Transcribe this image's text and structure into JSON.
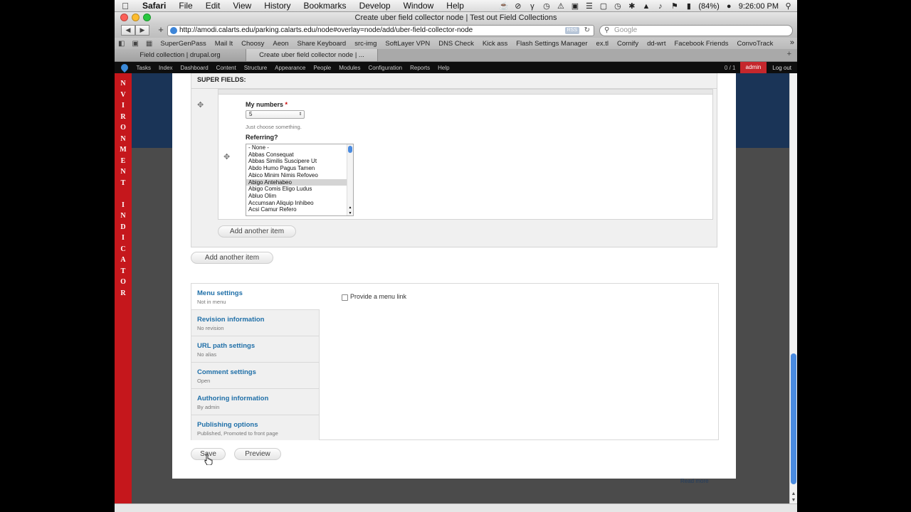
{
  "menubar": {
    "app": "Safari",
    "items": [
      "File",
      "Edit",
      "View",
      "History",
      "Bookmarks",
      "Develop",
      "Window",
      "Help"
    ],
    "battery": "(84%)",
    "clock": "9:26:00 PM"
  },
  "window": {
    "title": "Create uber field collector node | Test out Field Collections",
    "url": "http://amodi.calarts.edu/parking.calarts.edu/node#overlay=node/add/uber-field-collector-node",
    "rss": "RSS",
    "search_placeholder": "Google"
  },
  "bookmarks": [
    "SuperGenPass",
    "Mail It",
    "Choosy",
    "Aeon",
    "Share Keyboard",
    "src-img",
    "SoftLayer VPN",
    "DNS Check",
    "Kick ass",
    "Flash Settings Manager",
    "ex.tl",
    "Cornify",
    "dd-wrt",
    "Facebook Friends",
    "ConvoTrack"
  ],
  "tabs": [
    {
      "label": "Field collection | drupal.org"
    },
    {
      "label": "Create uber field collector node | ..."
    }
  ],
  "admin_toolbar": {
    "items": [
      "Tasks",
      "Index",
      "Dashboard",
      "Content",
      "Structure",
      "Appearance",
      "People",
      "Modules",
      "Configuration",
      "Reports",
      "Help"
    ],
    "count": "0 / 1",
    "user": "admin",
    "logout": "Log out"
  },
  "env_indicator": [
    "N",
    "V",
    "I",
    "R",
    "O",
    "N",
    "M",
    "E",
    "N",
    "T",
    " ",
    "I",
    "N",
    "D",
    "I",
    "C",
    "A",
    "T",
    "O",
    "R"
  ],
  "form": {
    "super_fields_label": "SUPER FIELDS:",
    "numbers_label": "My numbers",
    "required_mark": "*",
    "numbers_value": "5",
    "numbers_desc": "Just choose something.",
    "referring_label": "Referring?",
    "referring_options": [
      "- None -",
      "Abbas Consequat",
      "Abbas Similis Suscipere Ut",
      "Abdo Humo Pagus Tamen",
      "Abico Minim Nimis Refoveo",
      "Abigo Antehabeo",
      "Abigo Comis Eligo Ludus",
      "Abluo Olim",
      "Accumsan Aliquip Inhibeo",
      "Acsi Camur Refero"
    ],
    "referring_selected": "Abigo Antehabeo",
    "add_another_inner": "Add another item",
    "add_another_outer": "Add another item"
  },
  "vertical_tabs": [
    {
      "title": "Menu settings",
      "summary": "Not in menu"
    },
    {
      "title": "Revision information",
      "summary": "No revision"
    },
    {
      "title": "URL path settings",
      "summary": "No alias"
    },
    {
      "title": "Comment settings",
      "summary": "Open"
    },
    {
      "title": "Authoring information",
      "summary": "By admin"
    },
    {
      "title": "Publishing options",
      "summary": "Published, Promoted to front page"
    }
  ],
  "menu_pane": {
    "checkbox_label": "Provide a menu link"
  },
  "actions": {
    "save": "Save",
    "preview": "Preview"
  },
  "background": {
    "read_more": "Read more"
  },
  "colors": {
    "env_red": "#c5171c",
    "link_blue": "#1f6fa8",
    "admin_red": "#c5272c",
    "navy": "#1a3457"
  }
}
